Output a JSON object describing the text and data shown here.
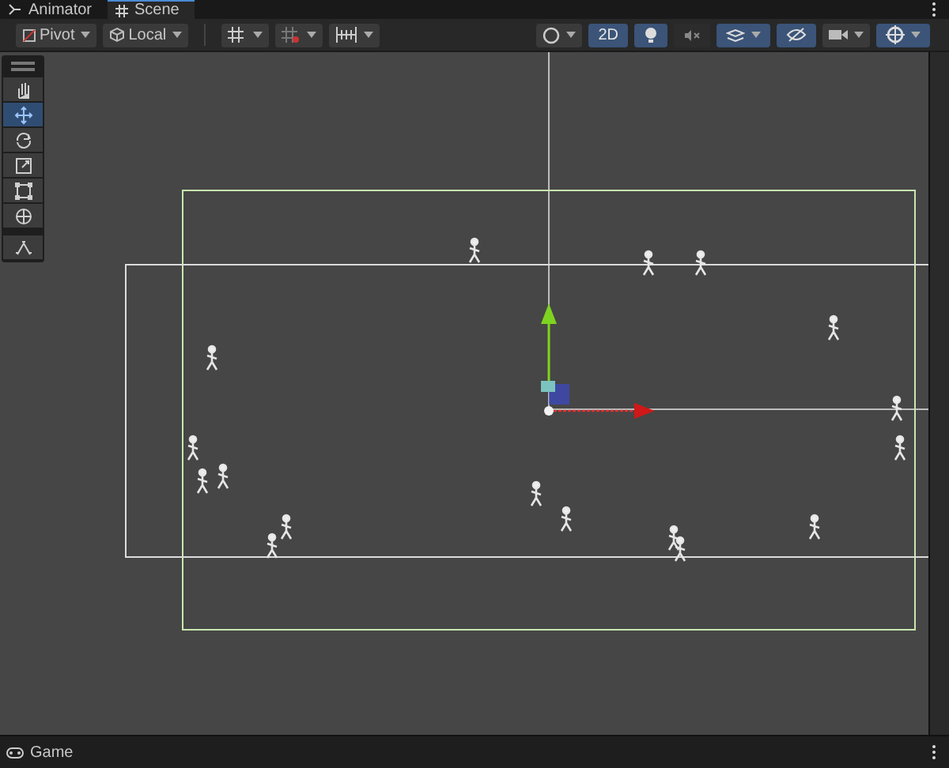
{
  "tabs": [
    {
      "label": "Animator",
      "selected": false
    },
    {
      "label": "Scene",
      "selected": true
    }
  ],
  "toolbar": {
    "pivot": "Pivot",
    "space": "Local",
    "mode_2d": {
      "label": "2D",
      "on": true
    },
    "lighting": {
      "on": true
    },
    "audio": {
      "on": false
    },
    "effects": {
      "on": true
    },
    "visibility": {
      "on": true
    },
    "gizmos": {
      "on": true
    }
  },
  "tools": [
    {
      "kind": "hand",
      "selected": false
    },
    {
      "kind": "move",
      "selected": true
    },
    {
      "kind": "rotate",
      "selected": false
    },
    {
      "kind": "scale",
      "selected": false
    },
    {
      "kind": "rect",
      "selected": false
    },
    {
      "kind": "transform",
      "selected": false
    },
    {
      "kind": "custom",
      "selected": false
    }
  ],
  "bottom_tabs": [
    {
      "label": "Game",
      "selected": false
    }
  ]
}
